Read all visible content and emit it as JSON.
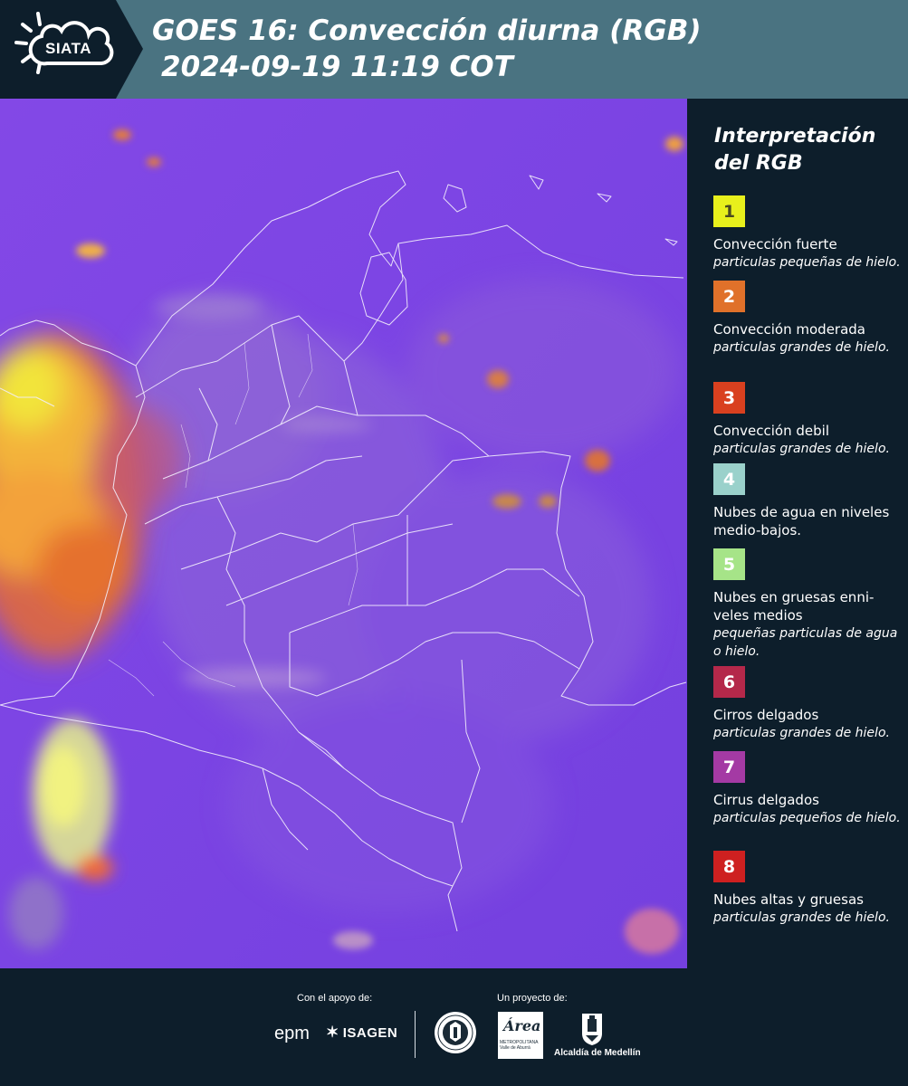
{
  "header": {
    "logo_text": "SIATA",
    "title_line1": "GOES 16: Convección diurna (RGB)",
    "title_line2": "2024-09-19 11:19 COT"
  },
  "legend": {
    "title": "Interpretación del RGB",
    "items": [
      {
        "number": "1",
        "color": "#e8f01c",
        "name": "Convección fuerte",
        "desc": "particulas pequeñas de hielo."
      },
      {
        "number": "2",
        "color": "#e0712a",
        "name": "Convección moderada",
        "desc": "particulas grandes de hielo."
      },
      {
        "number": "3",
        "color": "#d9401f",
        "name": "Convección debil",
        "desc": "particulas grandes de hielo."
      },
      {
        "number": "4",
        "color": "#9ad1cb",
        "name": "Nubes de agua en niveles medio-bajos.",
        "desc": ""
      },
      {
        "number": "5",
        "color": "#a6e488",
        "name": "Nubes en gruesas enni-veles medios",
        "desc": "pequeñas particulas de agua o hielo."
      },
      {
        "number": "6",
        "color": "#b4284a",
        "name": "Cirros delgados",
        "desc": "particulas grandes de hielo."
      },
      {
        "number": "7",
        "color": "#a43aa4",
        "name": "Cirrus delgados",
        "desc": "particulas pequeños de hielo."
      },
      {
        "number": "8",
        "color": "#ce2020",
        "name": "Nubes altas y gruesas",
        "desc": "particulas grandes de hielo."
      }
    ]
  },
  "footer": {
    "support_label": "Con el apoyo de:",
    "project_label": "Un proyecto de:",
    "epm": "epm",
    "isagen": "ISAGEN",
    "area_logo_word": "Área",
    "area_logo_sub": "METROPOLITANA Valle de Aburrá",
    "alcaldia": "Alcaldía de Medellín"
  },
  "colors": {
    "header_bg": "#4a7381",
    "panel_bg": "#0d1e2b",
    "map_base": "#7d45e2"
  }
}
